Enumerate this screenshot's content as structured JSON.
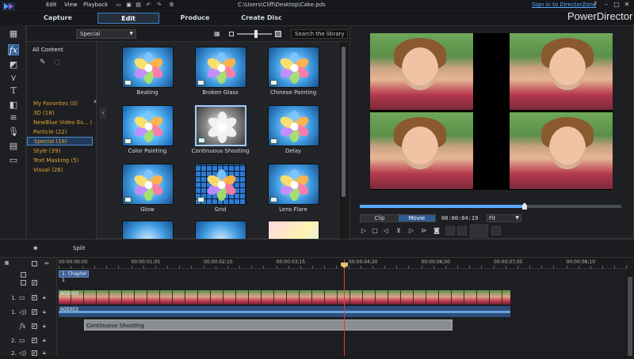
{
  "menu": {
    "edit": "Edit",
    "view": "View",
    "playback": "Playback"
  },
  "file_path": "C:\\Users\\Cliff\\Desktop\\Cake.pds",
  "sign_in": "Sign in to DirectorZone",
  "brand": "PowerDirector",
  "tabs": [
    {
      "label": "Capture"
    },
    {
      "label": "Edit"
    },
    {
      "label": "Produce"
    },
    {
      "label": "Create Disc"
    }
  ],
  "library": {
    "dropdown": "Special",
    "search_placeholder": "Search the library",
    "all_content": "All Content",
    "categories": [
      {
        "label": "My Favorites  (0)"
      },
      {
        "label": "3D  (18)"
      },
      {
        "label": "NewBlue Video Es...  (10)"
      },
      {
        "label": "Particle  (22)"
      },
      {
        "label": "Special  (18)"
      },
      {
        "label": "Style  (39)"
      },
      {
        "label": "Text Masking  (5)"
      },
      {
        "label": "Visual  (26)"
      }
    ],
    "effects": [
      {
        "label": "Beating"
      },
      {
        "label": "Broken Glass"
      },
      {
        "label": "Chinese Painting"
      },
      {
        "label": "Color Painting"
      },
      {
        "label": "Continuous Shooting"
      },
      {
        "label": "Delay"
      },
      {
        "label": "Glow"
      },
      {
        "label": "Grid"
      },
      {
        "label": "Lens Flare"
      }
    ]
  },
  "preview": {
    "clip": "Clip",
    "movie": "Movie",
    "timecode": "00:00:04:19",
    "fit": "Fit",
    "scrub_fraction": 0.63
  },
  "toolbar": {
    "split": "Split"
  },
  "timeline": {
    "ruler": [
      "00:00:00:00",
      "00:00:01;05",
      "00:00:02;10",
      "00:00:03;15",
      "00:00:04;20",
      "00:00:06;00",
      "00:00:07;05",
      "00:00:08;10"
    ],
    "chapter": "1. Chapter 1",
    "video_clip": "600003",
    "audio_clip": "600003",
    "fx_clip": "Continuous Shooting",
    "tracks": [
      {
        "n": "1."
      },
      {
        "n": "1."
      },
      {
        "n": "2."
      },
      {
        "n": "2."
      }
    ]
  },
  "colors": {
    "accent": "#3a7fc4",
    "category_text": "#e0a52e",
    "playhead": "#e23a3a"
  }
}
